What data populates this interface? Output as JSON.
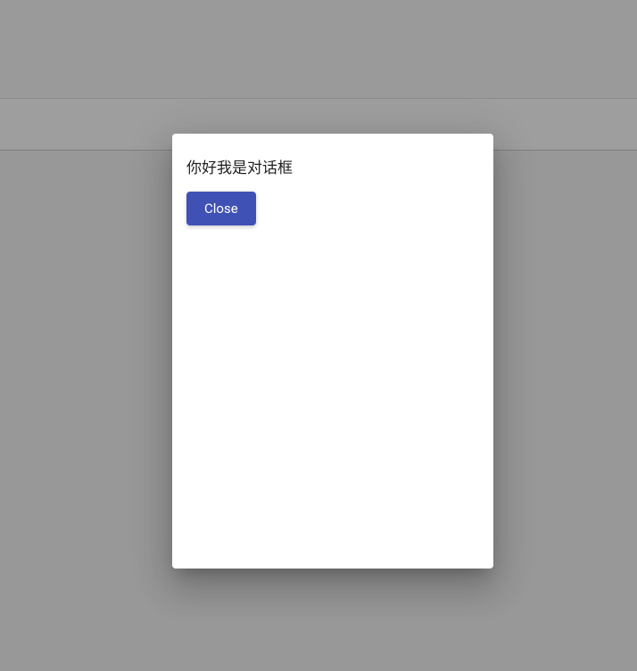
{
  "dialog": {
    "message": "你好我是对话框",
    "close_label": "Close"
  }
}
